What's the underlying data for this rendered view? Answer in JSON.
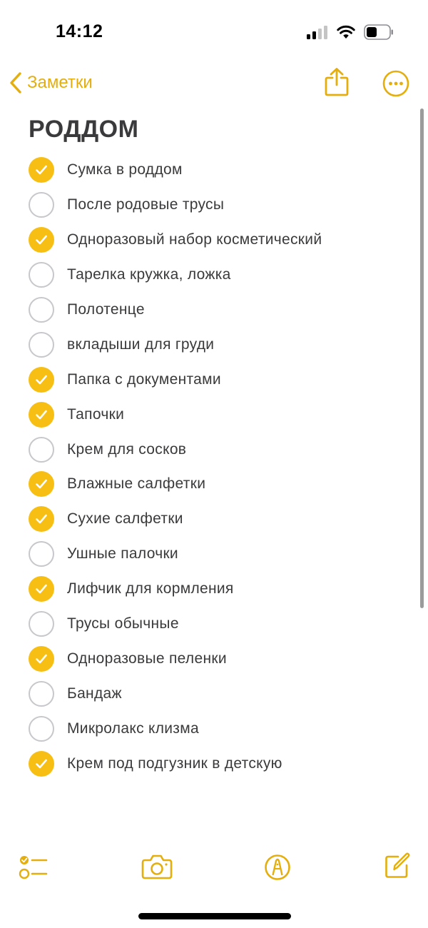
{
  "status_bar": {
    "time": "14:12"
  },
  "nav": {
    "back_label": "Заметки",
    "icons": {
      "back": "chevron-left-icon",
      "share": "share-icon",
      "more": "ellipsis-circle-icon"
    },
    "accent": "#e3ae0e"
  },
  "note": {
    "title": "РОДДОМ",
    "items": [
      {
        "label": "Сумка в роддом",
        "checked": true
      },
      {
        "label": "После родовые трусы",
        "checked": false
      },
      {
        "label": "Одноразовый набор косметический",
        "checked": true
      },
      {
        "label": "Тарелка кружка, ложка",
        "checked": false
      },
      {
        "label": "Полотенце",
        "checked": false
      },
      {
        "label": "вкладыши для груди",
        "checked": false
      },
      {
        "label": "Папка с документами",
        "checked": true
      },
      {
        "label": "Тапочки",
        "checked": true
      },
      {
        "label": "Крем для сосков",
        "checked": false
      },
      {
        "label": "Влажные салфетки",
        "checked": true
      },
      {
        "label": "Сухие салфетки",
        "checked": true
      },
      {
        "label": "Ушные палочки",
        "checked": false
      },
      {
        "label": "Лифчик для кормления",
        "checked": true
      },
      {
        "label": "Трусы обычные",
        "checked": false
      },
      {
        "label": "Одноразовые пеленки",
        "checked": true
      },
      {
        "label": "Бандаж",
        "checked": false
      },
      {
        "label": "Микролакс клизма",
        "checked": false
      },
      {
        "label": "Крем под подгузник в детскую",
        "checked": true
      }
    ]
  },
  "toolbar": {
    "icons": [
      "checklist-icon",
      "camera-icon",
      "markup-pen-icon",
      "compose-icon"
    ]
  },
  "colors": {
    "accent": "#e3ae0e",
    "checkbox_fill": "#f7be13",
    "text": "#3a3a3c",
    "unchecked_border": "#c7c7cc"
  }
}
